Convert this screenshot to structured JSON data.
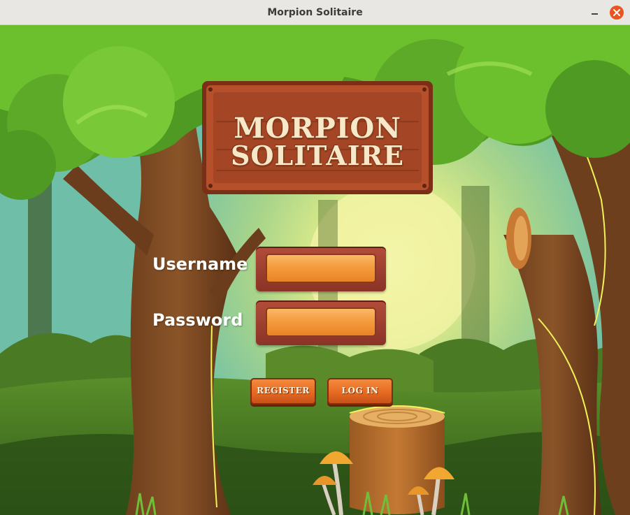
{
  "window": {
    "title": "Morpion Solitaire"
  },
  "sign": {
    "line1": "MORPION",
    "line2": "SOLITAIRE"
  },
  "form": {
    "username_label": "Username",
    "password_label": "Password",
    "username_value": "",
    "password_value": ""
  },
  "buttons": {
    "register": "REGISTER",
    "login": "LOG IN"
  },
  "colors": {
    "accent": "#e95420",
    "button": "#e56a22",
    "field": "#f49c3e",
    "sign_wood": "#b5502b"
  }
}
